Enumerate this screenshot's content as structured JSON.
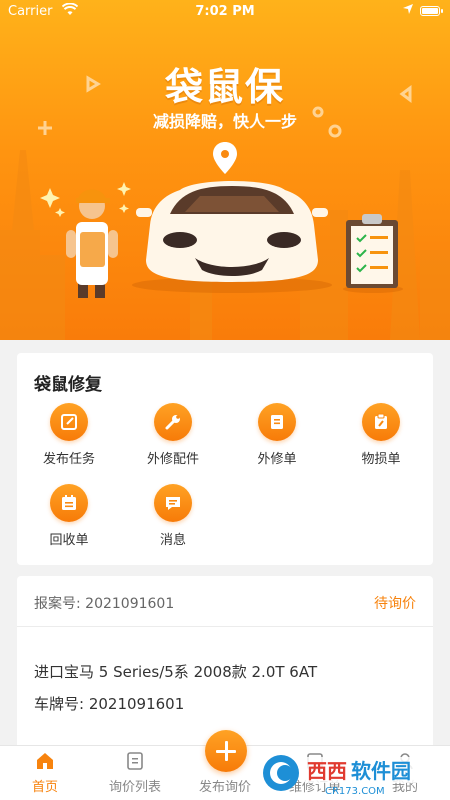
{
  "status_bar": {
    "carrier": "Carrier",
    "time": "7:02 PM"
  },
  "hero": {
    "title": "袋鼠保",
    "slogan": "减损降赔，快人一步"
  },
  "repair_section": {
    "title": "袋鼠修复",
    "items": [
      {
        "label": "发布任务",
        "icon": "edit-icon"
      },
      {
        "label": "外修配件",
        "icon": "wrench-icon"
      },
      {
        "label": "外修单",
        "icon": "document-icon"
      },
      {
        "label": "物损单",
        "icon": "clipboard-wrench-icon"
      },
      {
        "label": "回收单",
        "icon": "calendar-icon"
      },
      {
        "label": "消息",
        "icon": "message-icon"
      }
    ]
  },
  "order_card": {
    "case_number": "报案号: 2021091601",
    "status": "待询价",
    "car_model": "进口宝马 5 Series/5系 2008款 2.0T 6AT",
    "plate": "车牌号: 2021091601"
  },
  "tab_bar": {
    "tabs": [
      {
        "label": "首页",
        "icon": "home-icon",
        "active": true
      },
      {
        "label": "询价列表",
        "icon": "list-icon",
        "active": false
      },
      {
        "label": "发布询价",
        "icon": "plus-icon",
        "active": false
      },
      {
        "label": "维修订单",
        "icon": "order-icon",
        "active": false
      },
      {
        "label": "我的",
        "icon": "user-icon",
        "active": false
      }
    ]
  },
  "watermark": {
    "brand": "西西软件园",
    "domain": "CR173.COM"
  },
  "colors": {
    "accent": "#f7830e",
    "hero_top": "#ffb21a",
    "hero_bottom": "#f97c0a"
  }
}
